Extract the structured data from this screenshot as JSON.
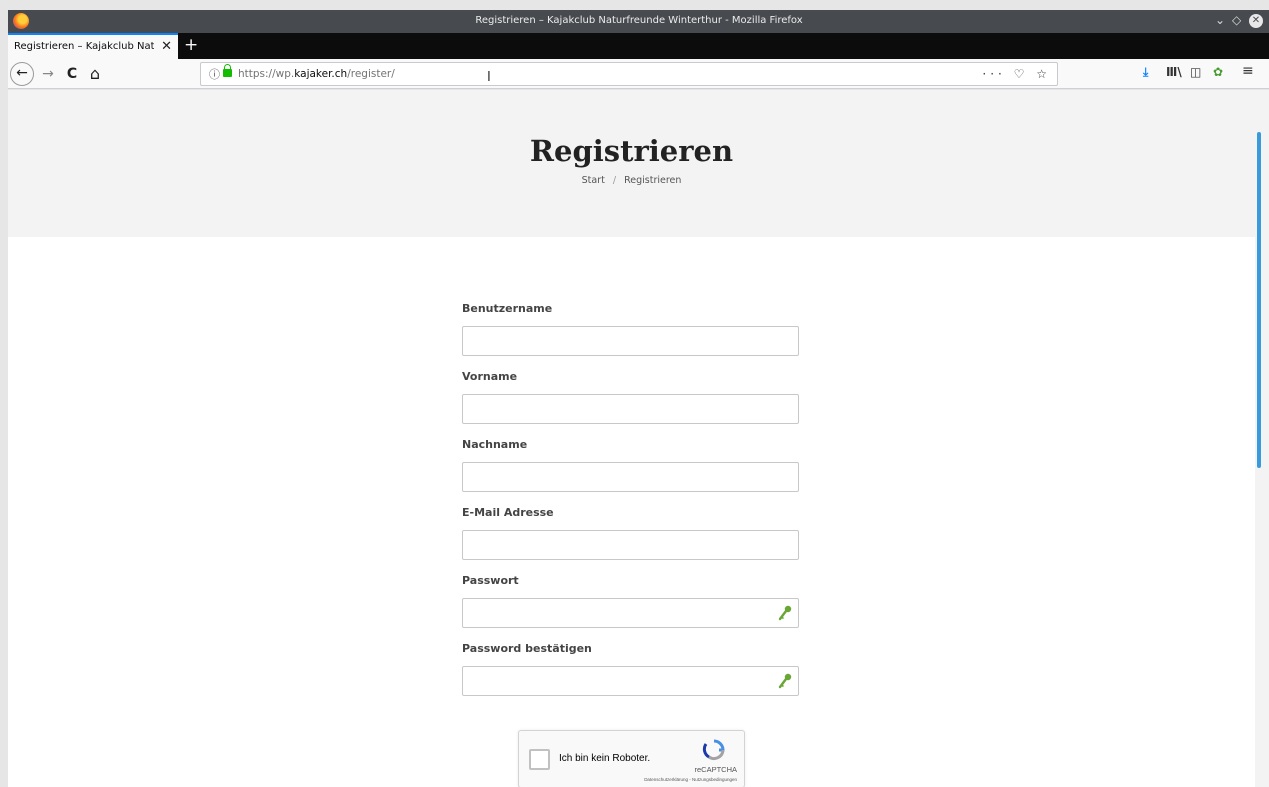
{
  "window": {
    "title": "Registrieren – Kajakclub Naturfreunde Winterthur - Mozilla Firefox"
  },
  "tab": {
    "label": "Registrieren – Kajakclub Natur",
    "close": "✕",
    "new": "+"
  },
  "toolbar": {
    "back": "←",
    "forward": "→",
    "reload": "C",
    "home": "⌂",
    "url_prefix": "https://wp.",
    "url_domain": "kajaker.ch",
    "url_path": "/register/",
    "page_actions": "··· ♡ ☆"
  },
  "page": {
    "title": "Registrieren",
    "breadcrumb": {
      "home": "Start",
      "separator": "/",
      "current": "Registrieren"
    },
    "fields": [
      {
        "label": "Benutzername",
        "value": ""
      },
      {
        "label": "Vorname",
        "value": ""
      },
      {
        "label": "Nachname",
        "value": ""
      },
      {
        "label": "E-Mail Adresse",
        "value": ""
      },
      {
        "label": "Passwort",
        "value": ""
      },
      {
        "label": "Password bestätigen",
        "value": ""
      }
    ],
    "captcha": {
      "label": "Ich bin kein Roboter.",
      "brand": "reCAPTCHA",
      "links": "Datenschutzerklärung - Nutzungsbedingungen"
    }
  },
  "colors": {
    "accent": "#0a84ff",
    "scroll_thumb": "#3a9bdc",
    "key_icon": "#6aa636",
    "lock": "#12bc00"
  }
}
